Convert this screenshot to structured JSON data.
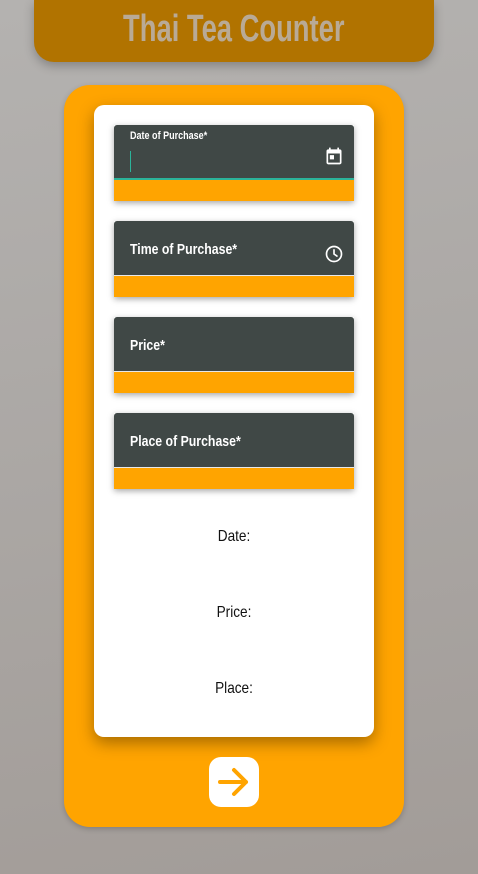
{
  "app": {
    "title": "Thai Tea Counter"
  },
  "form": {
    "date_label": "Date of Purchase*",
    "time_label": "Time of Purchase*",
    "price_label": "Price*",
    "place_label": "Place of Purchase*"
  },
  "summary": {
    "date_label": "Date:",
    "price_label": "Price:",
    "place_label": "Place:"
  },
  "icons": {
    "date": "calendar-icon",
    "time": "clock-icon",
    "next": "arrow-right-icon"
  },
  "colors": {
    "accent": "#ffa400",
    "header": "#b17300",
    "field": "#404846",
    "focus": "#2bb39a"
  }
}
